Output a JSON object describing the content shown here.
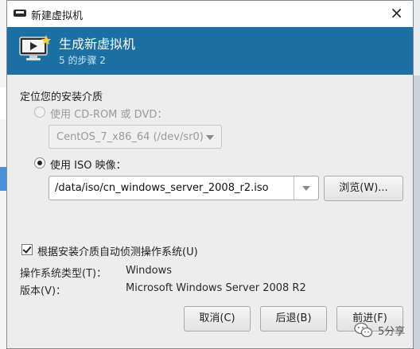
{
  "window": {
    "title": "新建虚拟机",
    "close_glyph": "×"
  },
  "header": {
    "title": "生成新虚拟机",
    "step": "5 的步骤 2",
    "icon": "monitor-play-icon"
  },
  "install_media": {
    "section_label": "定位您的安装介质",
    "cdrom_option": {
      "label": "使用 CD-ROM 或 DVD：",
      "selected": false,
      "enabled": false,
      "device_value": "CentOS_7_x86_64 (/dev/sr0)"
    },
    "iso_option": {
      "label": "使用 ISO 映像：",
      "selected": true,
      "path_value": "/data/iso/cn_windows_server_2008_r2.iso",
      "browse_label": "浏览(W)..."
    }
  },
  "os_detection": {
    "checkbox_label": "根据安装介质自动侦测操作系统(U)",
    "checked": true,
    "os_type_label": "操作系统类型(T)：",
    "os_type_value": "Windows",
    "version_label": "版本(V)：",
    "version_value": "Microsoft Windows Server 2008 R2"
  },
  "footer": {
    "cancel_label": "取消(C)",
    "back_label": "后退(B)",
    "forward_label": "前进(F)"
  },
  "watermark": {
    "text": "5分享",
    "icon": "wechat-icon"
  },
  "colors": {
    "header_bg": "#1c70a4",
    "window_bg": "#ededed"
  }
}
